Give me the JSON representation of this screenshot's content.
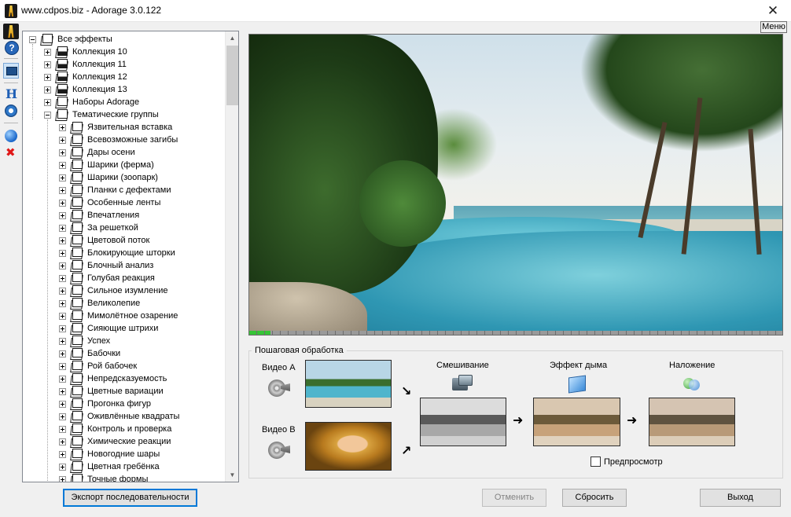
{
  "window": {
    "title": "www.cdpos.biz - Adorage 3.0.122",
    "close_glyph": "✕"
  },
  "toolbar": {
    "icons": [
      "adorage-logo-icon",
      "help-icon",
      "monitor-icon",
      "wand-icon",
      "settings-gear-icon",
      "blue-ball-icon",
      "red-x-icon"
    ]
  },
  "menu_button": "Меню",
  "tree": {
    "root": "Все эффекты",
    "collections": [
      "Коллекция 10",
      "Коллекция 11",
      "Коллекция 12",
      "Коллекция 13",
      "Наборы Adorage"
    ],
    "thematic": "Тематические группы",
    "groups": [
      "Язвительная вставка",
      "Всевозможные загибы",
      "Дары осени",
      "Шарики (ферма)",
      "Шарики (зоопарк)",
      "Планки с дефектами",
      "Особенные ленты",
      "Впечатления",
      "За решеткой",
      "Цветовой поток",
      "Блокирующие шторки",
      "Блочный анализ",
      "Голубая реакция",
      "Сильное изумление",
      "Великолепие",
      "Мимолётное озарение",
      "Сияющие штрихи",
      "Успех",
      "Бабочки",
      "Рой бабочек",
      "Непредсказуемость",
      "Цветные вариации",
      "Прогонка фигур",
      "Оживлённые квадраты",
      "Контроль и проверка",
      "Химические реакции",
      "Новогодние шары",
      "Цветная гребёнка",
      "Точные формы"
    ]
  },
  "preview": {
    "progress_fraction": 0.04
  },
  "steps": {
    "group_title": "Пошаговая обработка",
    "video_a": "Видео A",
    "video_b": "Видео B",
    "mixing": "Смешивание",
    "smoke": "Эффект дыма",
    "overlay": "Наложение",
    "preview_checkbox": "Предпросмотр",
    "arrow_glyph": "➜",
    "arrow_down_glyph": "↘",
    "arrow_up_glyph": "↗"
  },
  "buttons": {
    "export": "Экспорт последовательности",
    "cancel": "Отменить",
    "reset": "Сбросить",
    "exit": "Выход"
  }
}
